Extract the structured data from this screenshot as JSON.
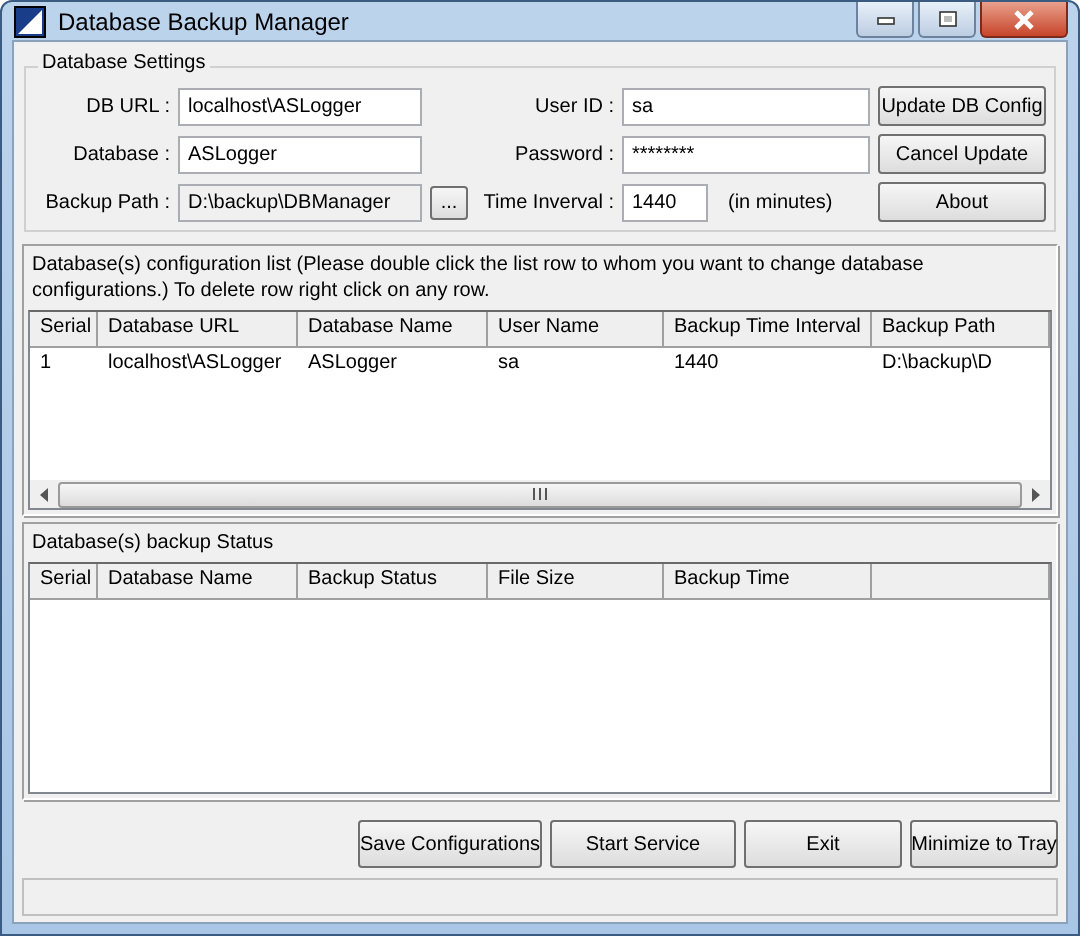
{
  "window": {
    "title": "Database Backup Manager"
  },
  "settings": {
    "title": "Database Settings",
    "rows": [
      {
        "label": "DB URL :",
        "value": "localhost\\ASLogger",
        "readonly": false,
        "right_label": "User ID :",
        "right_value": "sa",
        "button": "Update DB Config"
      },
      {
        "label": "Database :",
        "value": "ASLogger",
        "readonly": false,
        "right_label": "Password :",
        "right_value": "********",
        "button": "Cancel Update"
      },
      {
        "label": "Backup Path :",
        "value": "D:\\backup\\DBManager",
        "readonly": true,
        "browse": "...",
        "right_label": "Time Inverval :",
        "right_value": "1440",
        "suffix": "(in minutes)",
        "button": "About"
      }
    ]
  },
  "config_list": {
    "caption": "Database(s) configuration list (Please double click the list row to whom you want to change database configurations.) To delete row right click on any row.",
    "columns": [
      "Serial",
      "Database URL",
      "Database Name",
      "User Name",
      "Backup Time Interval",
      "Backup Path"
    ],
    "rows": [
      [
        "1",
        "localhost\\ASLogger",
        "ASLogger",
        "sa",
        "1440",
        "D:\\backup\\D"
      ]
    ]
  },
  "status_list": {
    "caption": "Database(s) backup Status",
    "columns": [
      "Serial",
      "Database Name",
      "Backup Status",
      "File Size",
      "Backup Time"
    ]
  },
  "buttons": [
    "Save Configurations",
    "Start Service",
    "Exit",
    "Minimize to Tray"
  ]
}
